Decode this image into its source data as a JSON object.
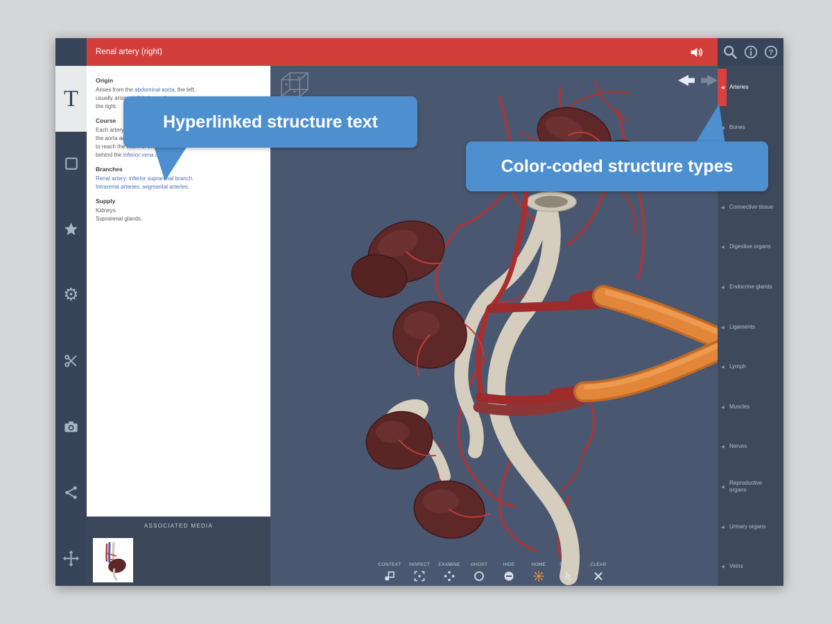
{
  "app": {
    "title": "Renal artery (right)"
  },
  "titlebar_icons": [
    "speaker-icon"
  ],
  "top_right_icons": [
    "search-icon",
    "info-icon",
    "help-icon"
  ],
  "sidebar": {
    "text_tool_glyph": "T",
    "tools": [
      "text",
      "structures",
      "favorites",
      "settings",
      "dissect",
      "snapshot",
      "share",
      "move"
    ]
  },
  "info_panel": {
    "sections": [
      {
        "heading": "Origin",
        "lines": [
          [
            {
              "t": "Arises from the "
            },
            {
              "t": "abdominal aorta",
              "link": true
            },
            {
              "t": ", the left,"
            }
          ],
          [
            {
              "t": "usually arising a little lower than"
            }
          ],
          [
            {
              "t": "the right."
            }
          ]
        ]
      },
      {
        "heading": "Course",
        "lines": [
          [
            {
              "t": "Each artery passes laterally behind"
            }
          ],
          [
            {
              "t": "the aorta and the renal vein"
            }
          ],
          [
            {
              "t": "to reach the hilum of the kidney,"
            }
          ],
          [
            {
              "t": "behind the "
            },
            {
              "t": "inferior vena cava",
              "link": true
            },
            {
              "t": "."
            }
          ]
        ]
      },
      {
        "heading": "Branches",
        "lines": [
          [
            {
              "t": "Renal artery: inferior suprarenal branch.",
              "link": true
            }
          ],
          [
            {
              "t": "Intrarenal arteries: segmental arteries.",
              "link": true
            }
          ]
        ]
      },
      {
        "heading": "Supply",
        "lines": [
          [
            {
              "t": "Kidneys."
            }
          ],
          [
            {
              "t": "Suprarenal glands."
            }
          ]
        ]
      }
    ],
    "associated_media": "ASSOCIATED MEDIA"
  },
  "structures_panel": {
    "items": [
      {
        "label": "Arteries",
        "active": true
      },
      {
        "label": "Bones"
      },
      {
        "label": ""
      },
      {
        "label": "Connective tissue"
      },
      {
        "label": "Digestive organs"
      },
      {
        "label": "Endocrine glands"
      },
      {
        "label": "Ligaments"
      },
      {
        "label": "Lymph"
      },
      {
        "label": "Muscles"
      },
      {
        "label": "Nerves"
      },
      {
        "label": "Reproductive organs"
      },
      {
        "label": "Urinary organs"
      },
      {
        "label": "Veins"
      }
    ]
  },
  "viewport_toolbar": {
    "items": [
      {
        "label": "CONTEXT",
        "icon": "context"
      },
      {
        "label": "INSPECT",
        "icon": "inspect"
      },
      {
        "label": "EXAMINE",
        "icon": "examine"
      },
      {
        "label": "GHOST",
        "icon": "ghost"
      },
      {
        "label": "HIDE",
        "icon": "hide"
      },
      {
        "label": "HOME",
        "icon": "home",
        "active": true
      },
      {
        "label": "SINGLE",
        "icon": "single"
      },
      {
        "label": "CLEAR",
        "icon": "clear"
      }
    ]
  },
  "callouts": [
    {
      "text": "Hyperlinked structure text"
    },
    {
      "text": "Color-coded structure types"
    }
  ],
  "colors": {
    "titlebar_red": "#d23f3b",
    "chrome_dark": "#37445a",
    "panel_dark": "#3e4a5c",
    "viewport_bg": "#4a5770",
    "callout_blue": "#4e8fd0",
    "active_structure_red": "#d6403d",
    "hyperlink_blue": "#4a6fb5",
    "toolbar_active_orange": "#e8913a"
  }
}
